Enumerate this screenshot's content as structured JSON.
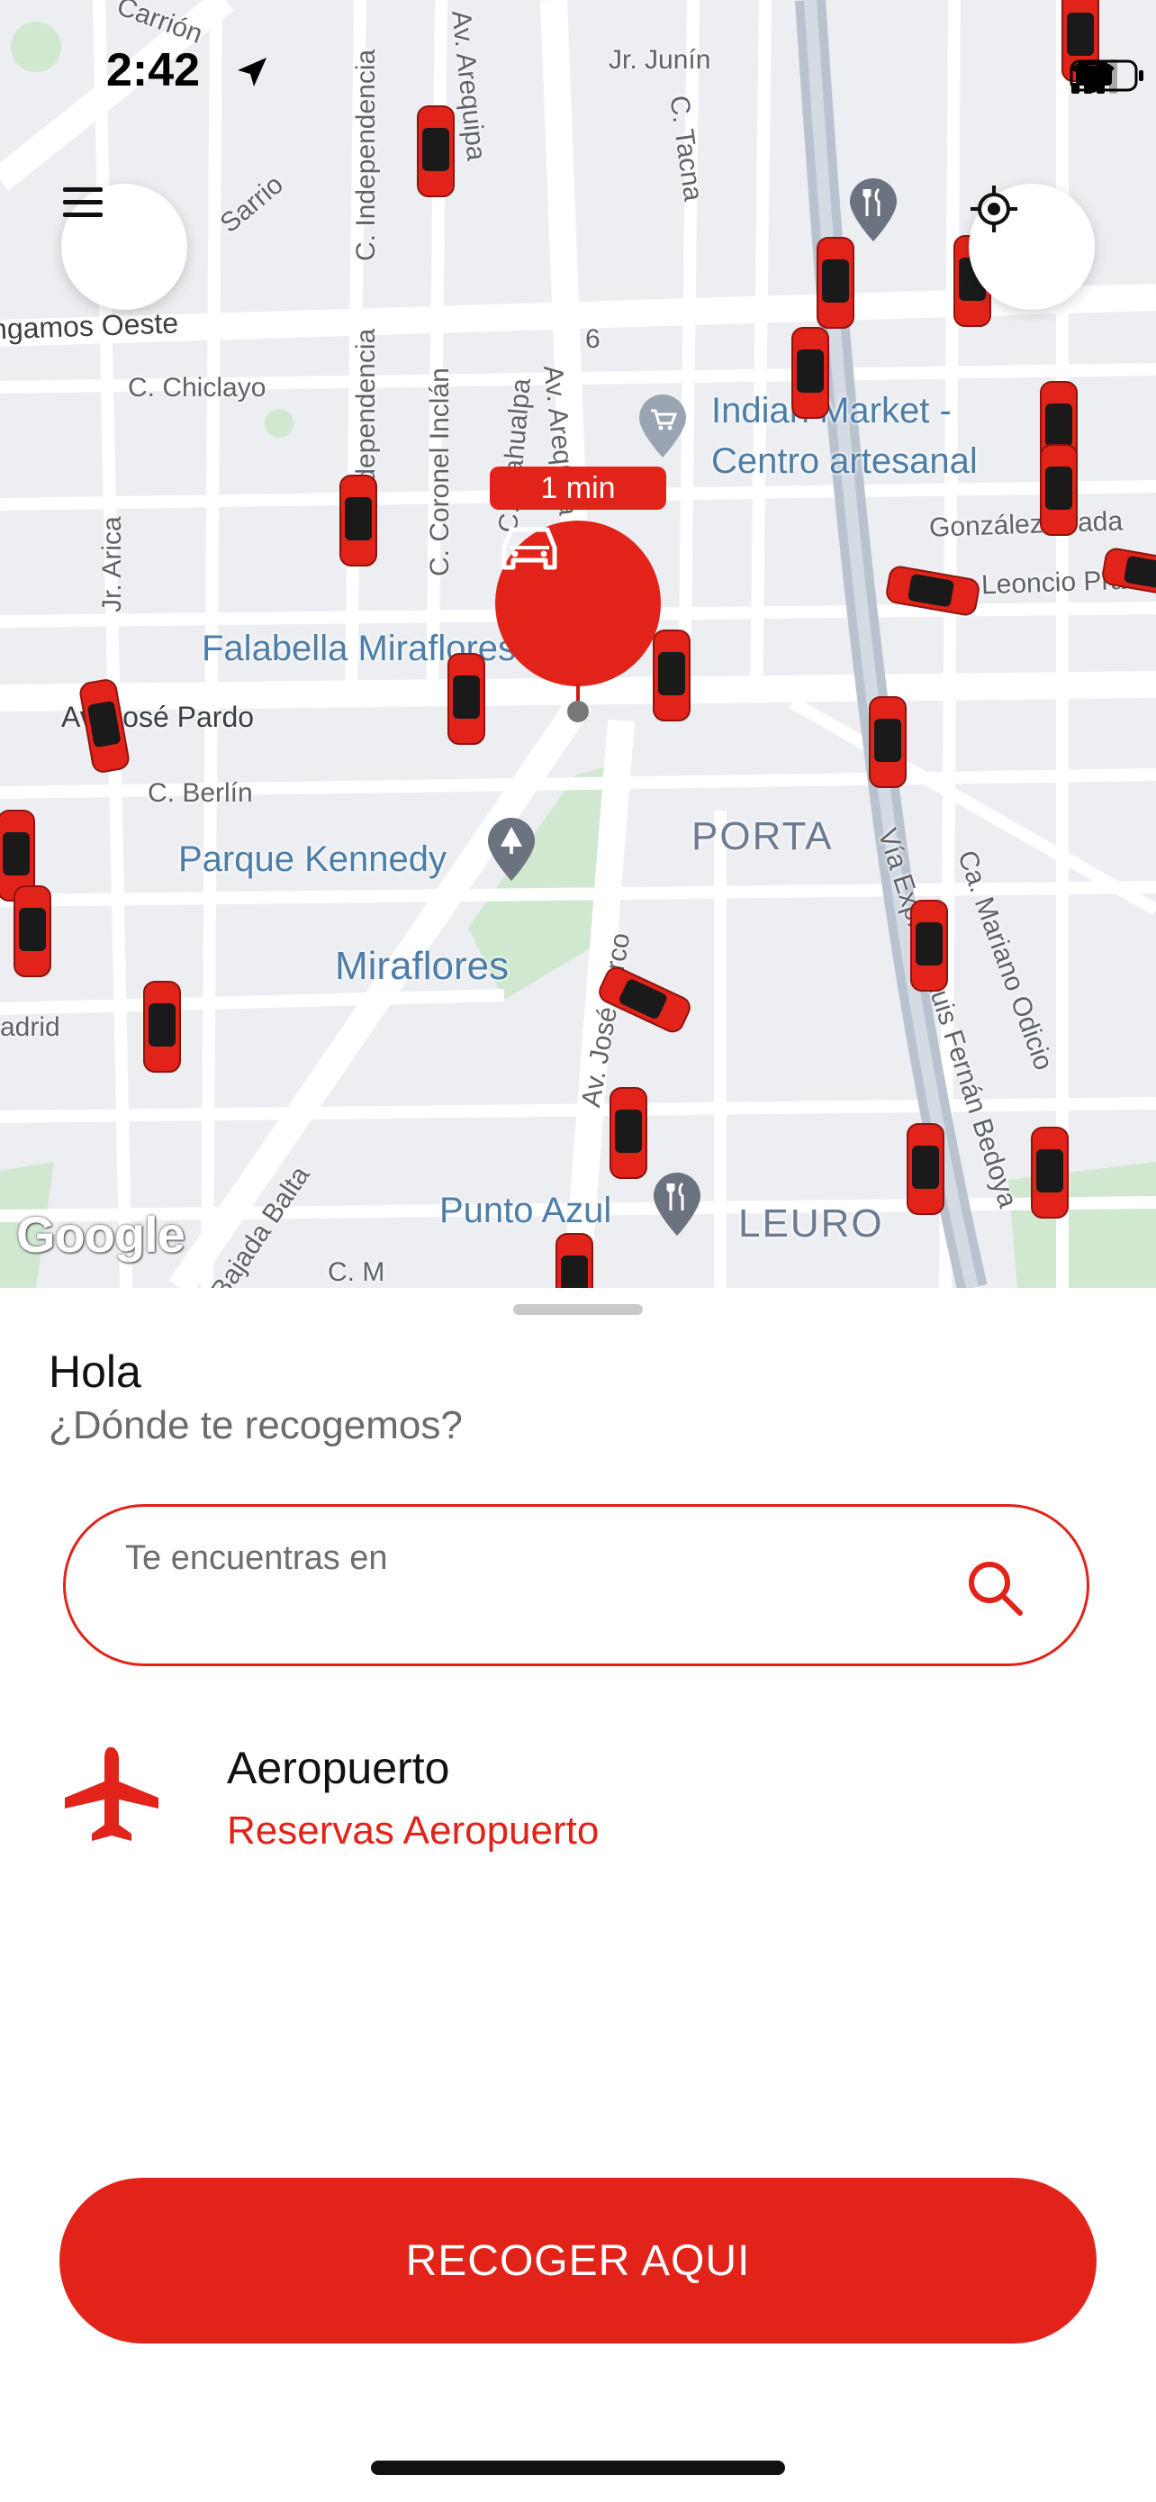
{
  "status_bar": {
    "time": "2:42"
  },
  "map": {
    "eta": "1 min",
    "attribution": "Google",
    "street_labels": {
      "carrion": "Carrión",
      "independencia": "C. Independencia",
      "arequipa": "Av. Arequipa",
      "junin": "Jr. Junín",
      "tacna": "C. Tacna",
      "sarrio": "Sarrio",
      "gamos_oeste": "ngamos Oeste",
      "chiclayo": "C. Chiclayo",
      "independencia2": "C. Independencia",
      "coronel_inclan": "C. Coronel Inclán",
      "atahualpa": "C. Atahualpa",
      "arequipa2": "Av. Arequipa",
      "arica": "Jr. Arica",
      "gonzalez_prada": "González Prada",
      "leoncio_prado": "Leoncio Prado",
      "jose_pardo": "Av. José Pardo",
      "berlin": "C. Berlín",
      "mariano_odicio": "Ca. Mariano Odicio",
      "via_expresa": "Vía Expresa Luis Fernán Bedoya",
      "madrid": "adrid",
      "jose_larco": "Av. José Larco",
      "bajada_balta": "Bajada Balta",
      "c_m": "C. M",
      "number_6": "6"
    },
    "pois": {
      "indian_market": "Indian Market -",
      "centro_artesanal": "Centro artesanal",
      "falabella": "Falabella Miraflores",
      "parque_kennedy": "Parque Kennedy",
      "miraflores": "Miraflores",
      "punto_azul": "Punto Azul",
      "porta": "PORTA",
      "leuro": "LEURO"
    }
  },
  "sheet": {
    "greeting": "Hola",
    "question": "¿Dónde te recogemos?",
    "search": {
      "label": "Te encuentras en",
      "value": ""
    },
    "airport": {
      "title": "Aeropuerto",
      "subtitle": "Reservas Aeropuerto"
    },
    "primary_button": "RECOGER AQUI"
  },
  "colors": {
    "brand_red": "#e2231a",
    "map_bg": "#eceef1",
    "park_green": "#c8e6c9"
  },
  "icons": [
    "menu-icon",
    "my-location-icon",
    "car-icon",
    "search-icon",
    "airplane-icon",
    "cellular-signal-icon",
    "wifi-icon",
    "battery-icon",
    "location-arrow-icon"
  ]
}
